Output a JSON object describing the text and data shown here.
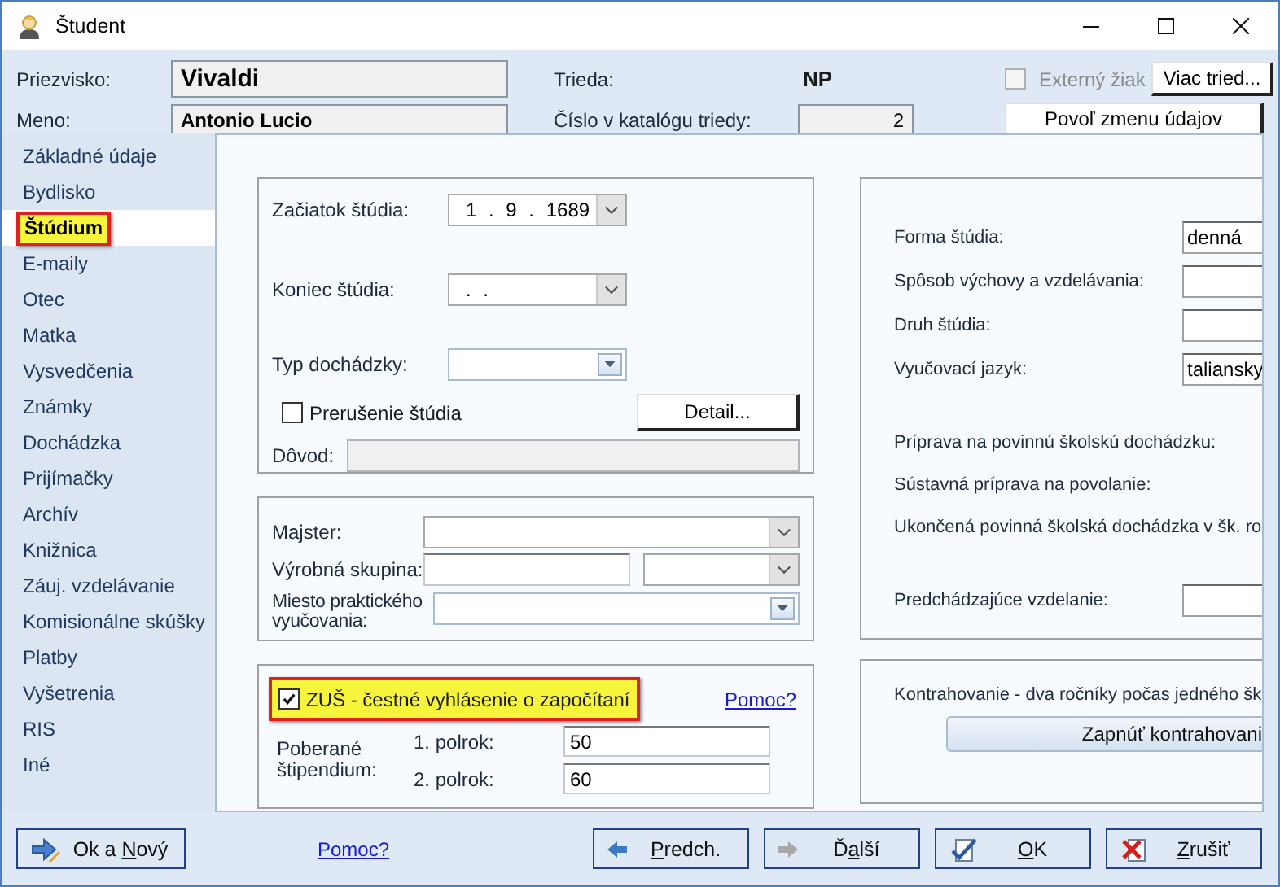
{
  "window": {
    "title": "Študent"
  },
  "header": {
    "surname": {
      "label": "Priezvisko:",
      "value": "Vivaldi"
    },
    "first_name": {
      "label": "Meno:",
      "value": "Antonio Lucio"
    },
    "class": {
      "label": "Trieda:",
      "value": "NP"
    },
    "catalog_number": {
      "label": "Číslo v katalógu triedy:",
      "value": "2"
    },
    "external_student": {
      "label": "Externý žiak",
      "checked": false,
      "disabled": true
    },
    "more_classes_button": "Viac tried...",
    "allow_change_button": "Povoľ zmenu údajov"
  },
  "sidebar": {
    "items": [
      {
        "label": "Základné údaje",
        "selected": false
      },
      {
        "label": "Bydlisko",
        "selected": false
      },
      {
        "label": "Štúdium",
        "selected": true
      },
      {
        "label": "E-maily",
        "selected": false
      },
      {
        "label": "Otec",
        "selected": false
      },
      {
        "label": "Matka",
        "selected": false
      },
      {
        "label": "Vysvedčenia",
        "selected": false
      },
      {
        "label": "Známky",
        "selected": false
      },
      {
        "label": "Dochádzka",
        "selected": false
      },
      {
        "label": "Prijímačky",
        "selected": false
      },
      {
        "label": "Archív",
        "selected": false
      },
      {
        "label": "Knižnica",
        "selected": false
      },
      {
        "label": "Záuj. vzdelávanie",
        "selected": false
      },
      {
        "label": "Komisionálne skúšky",
        "selected": false
      },
      {
        "label": "Platby",
        "selected": false
      },
      {
        "label": "Vyšetrenia",
        "selected": false
      },
      {
        "label": "RIS",
        "selected": false
      },
      {
        "label": "Iné",
        "selected": false
      }
    ]
  },
  "study_group": {
    "start": {
      "label": "Začiatok štúdia:",
      "value": "1 . 9 . 1689"
    },
    "end": {
      "label": "Koniec štúdia:",
      "value": ". ."
    },
    "attendance_type": {
      "label": "Typ dochádzky:"
    },
    "interruption": {
      "label": "Prerušenie štúdia",
      "checked": false
    },
    "detail_button": "Detail...",
    "reason": {
      "label": "Dôvod:"
    }
  },
  "training_group": {
    "master": {
      "label": "Majster:"
    },
    "production_group": {
      "label": "Výrobná skupina:"
    },
    "practice_place": {
      "label": "Miesto praktického vyučovania:"
    }
  },
  "zus_group": {
    "declaration": {
      "label": "ZUŠ - čestné vyhlásenie o započítaní",
      "checked": true,
      "highlighted": true
    },
    "help_link": "Pomoc?",
    "stipend_label": "Poberané štipendium:",
    "semesters": [
      {
        "label": "1. polrok:",
        "value": "50"
      },
      {
        "label": "2. polrok:",
        "value": "60"
      }
    ]
  },
  "study_details": {
    "rows": [
      {
        "kind": "field",
        "label": "Forma štúdia:",
        "value": "denná"
      },
      {
        "kind": "field",
        "label": "Spôsob výchovy a vzdelávania:"
      },
      {
        "kind": "field",
        "label": "Druh štúdia:"
      },
      {
        "kind": "field",
        "label": "Vyučovací jazyk:",
        "value": "taliansky"
      },
      {
        "kind": "text",
        "label": "Príprava na povinnú školskú dochádzku:"
      },
      {
        "kind": "text",
        "label": "Sústavná príprava na povolanie:"
      },
      {
        "kind": "text",
        "label": "Ukončená povinná školská dochádzka v šk. ro"
      },
      {
        "kind": "field",
        "label": "Predchádzajúce vzdelanie:"
      }
    ]
  },
  "contraction": {
    "text": "Kontrahovanie - dva ročníky počas jedného šk",
    "button": "Zapnúť kontrahovani"
  },
  "footer": {
    "new_button": {
      "kind": "ok_new",
      "before": "Ok a ",
      "access_key": "N",
      "after": "ový"
    },
    "help_link": "Pomoc?",
    "buttons": [
      {
        "kind": "prev",
        "access_key": "P",
        "after": "redch."
      },
      {
        "kind": "next",
        "before": "Ď",
        "access_key": "a",
        "after": "lší"
      },
      {
        "kind": "ok",
        "access_key": "O",
        "after": "K"
      },
      {
        "kind": "cancel",
        "access_key": "Z",
        "after": "rušiť"
      }
    ]
  }
}
